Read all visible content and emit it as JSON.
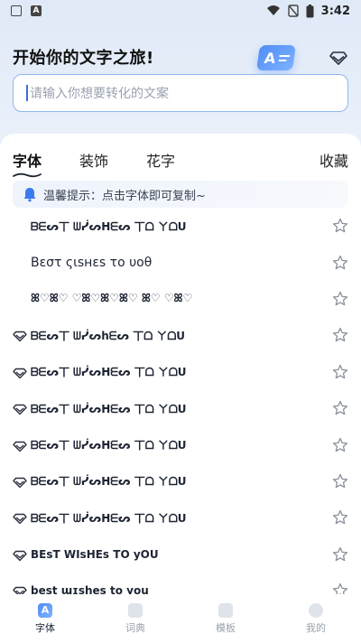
{
  "status": {
    "time": "3:42",
    "a_icon_label": "A"
  },
  "header": {
    "title": "开始你的文字之旅!",
    "art_letter": "A"
  },
  "search": {
    "placeholder": "请输入你想要转化的文案"
  },
  "tabs": [
    {
      "label": "字体",
      "active": true
    },
    {
      "label": "装饰",
      "active": false
    },
    {
      "label": "花字",
      "active": false
    }
  ],
  "collect_label": "收藏",
  "notice": {
    "text": "温馨提示：点击字体即可复制~"
  },
  "fonts": [
    {
      "text": "ᗷᗴᔕ丅 ᗯᓰᔕᕼᗴᔕ 丅ᗝ ㄚᗝᑌ",
      "vip": false,
      "big": false
    },
    {
      "text": "Bεστ ςιѕнεѕ το υoθ",
      "vip": false,
      "big": true
    },
    {
      "text": "ꕤ♡ꕤ♡ ♡ꕤ♡ꕤ♡ꕤ♡ ꕤ♡ ♡ꕤ♡",
      "vip": false,
      "big": false
    },
    {
      "text": "ᗷᗴᔕ丅 ᗯᓰᔕhᗴᔕ 丅ᗝ ㄚᗝᑌ",
      "vip": true,
      "big": false
    },
    {
      "text": "ᗷᗴᔕ丅 ᗯᓰᔕᕼᗴᔕ 丅ᗝ ㄚᗝᑌ",
      "vip": true,
      "big": false
    },
    {
      "text": "ᗷᗴᔕ丅 ᗯᓰᔕᕼᗴᔕ 丅ᗝ ㄚᗝᑌ",
      "vip": true,
      "big": false
    },
    {
      "text": "ᗷᗴᔕ丅 ᗯᓰᔕᕼᗴᔕ 丅ᗝ ㄚᗝᑌ",
      "vip": true,
      "big": false
    },
    {
      "text": "ᗷᗴᔕ丅 ᗯᓰᔕᕼᗴᔕ 丅ᗝ ㄚᗝᑌ",
      "vip": true,
      "big": false
    },
    {
      "text": "ᗷᗴᔕ丅 ᗯᓰᔕᕼᗴᔕ 丅ᗝ ㄚᗝᑌ",
      "vip": true,
      "big": false
    },
    {
      "text": "BEsT WIsHEs TO yOU",
      "vip": true,
      "big": false
    },
    {
      "text": "best ɯɪshes to you",
      "vip": true,
      "big": false
    }
  ],
  "nav": [
    {
      "label": "字体",
      "active": true,
      "icon": "font-icon"
    },
    {
      "label": "词典",
      "active": false,
      "icon": "dictionary-icon"
    },
    {
      "label": "模板",
      "active": false,
      "icon": "template-icon"
    },
    {
      "label": "我的",
      "active": false,
      "icon": "profile-icon"
    }
  ],
  "colors": {
    "accent": "#3a6fd8",
    "tab_text": "#222222",
    "nav_inactive": "#9aa1ad"
  }
}
